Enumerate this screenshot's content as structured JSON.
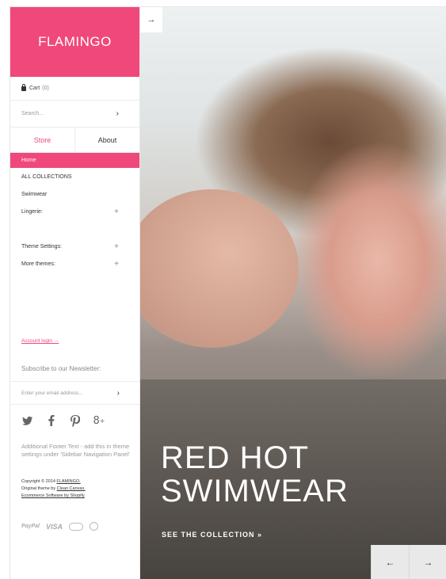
{
  "brand": {
    "name": "FLAMINGO",
    "color": "#f0487a"
  },
  "cart": {
    "label": "Cart",
    "count": "(0)"
  },
  "search": {
    "placeholder": "Search..."
  },
  "tabs": [
    {
      "label": "Store"
    },
    {
      "label": "About"
    }
  ],
  "nav": {
    "items": [
      {
        "label": "Home"
      },
      {
        "label": "ALL COLLECTIONS"
      },
      {
        "label": "Swimwear"
      },
      {
        "label": "Lingerie:"
      }
    ],
    "settings": [
      {
        "label": "Theme Settings:"
      },
      {
        "label": "More themes:"
      }
    ]
  },
  "account": {
    "label": "Account login →"
  },
  "newsletter": {
    "label": "Subscribe to our Newsletter:",
    "placeholder": "Enter your email address..."
  },
  "social": {
    "icons": [
      "twitter-icon",
      "facebook-icon",
      "pinterest-icon",
      "google-plus-icon"
    ]
  },
  "footer": {
    "text": "Additional Footer Text - add this in theme settings under 'Sidebar Navigation Panel'"
  },
  "copyright": {
    "line1_prefix": "Copyright © 2014 ",
    "line1_link": "FLAMINGO.",
    "line2_prefix": "Original theme by ",
    "line2_link": "Clean Canvas.",
    "line3_link": "Ecommerce Software by Shopify"
  },
  "payments": {
    "paypal": "PayPal",
    "visa": "VISA"
  },
  "hero": {
    "headline_line1": "RED HOT",
    "headline_line2": "SWIMWEAR",
    "cta": "SEE THE COLLECTION »"
  }
}
